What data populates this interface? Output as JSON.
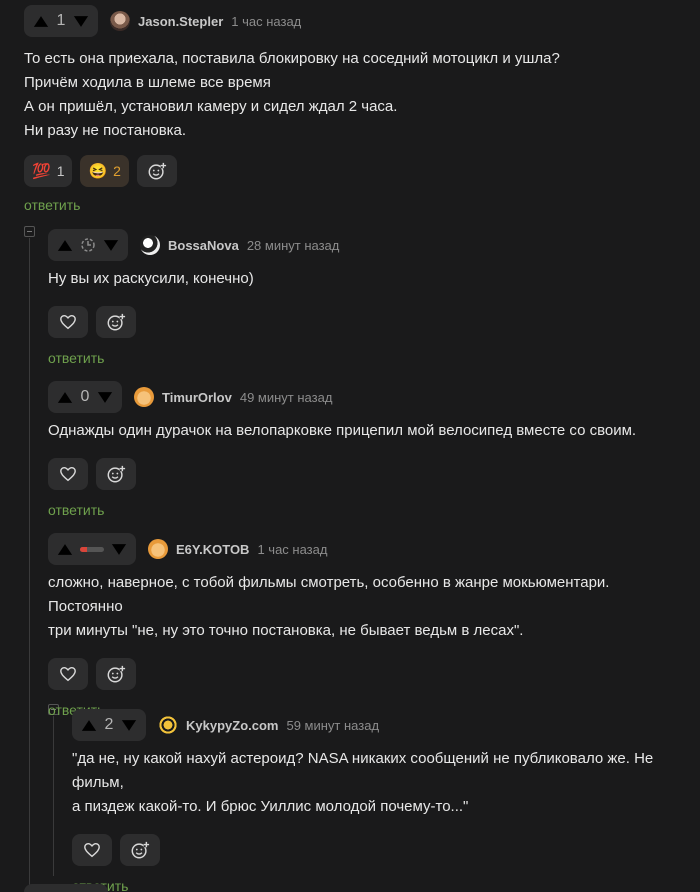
{
  "comments": [
    {
      "score": "1",
      "author": "Jason.Stepler",
      "time": "1 час назад",
      "lines": [
        "То есть она приехала, поставила блокировку на соседний мотоцикл и ушла?",
        "Причём ходила в шлеме все время",
        "А он пришёл, установил камеру и сидел ждал 2 часа.",
        "Ни разу не постановка."
      ],
      "reactions": [
        {
          "icon": "hundred-points-icon",
          "glyph": "💯",
          "count": "1"
        },
        {
          "icon": "laughing-face-icon",
          "glyph": "😆",
          "count": "2"
        }
      ],
      "reply": "ответить"
    },
    {
      "score": "",
      "author": "BossaNova",
      "time": "28 минут назад",
      "lines": [
        "Ну вы их раскусили, конечно)"
      ],
      "reply": "ответить"
    },
    {
      "score": "0",
      "author": "TimurOrlov",
      "time": "49 минут назад",
      "lines": [
        "Однажды один дурачок на велопарковке прицепил мой велосипед вместе со своим."
      ],
      "reply": "ответить"
    },
    {
      "score": "",
      "author": "E6Y.KOTOB",
      "time": "1 час назад",
      "lines": [
        "сложно, наверное, с тобой фильмы смотреть, особенно в жанре мокьюментари. Постоянно",
        "три минуты \"не, ну это точно постановка, не бывает ведьм в лесах\"."
      ],
      "reply": "ответить"
    },
    {
      "score": "2",
      "author": "KykypyZo.com",
      "time": "59 минут назад",
      "lines": [
        "\"да не, ну какой нахуй астероид? NASA никаких сообщений не публиковало же. Не фильм,",
        "а пиздеж какой-то. И брюс Уиллис молодой почему-то...\""
      ],
      "reply": "ответить"
    }
  ],
  "colors": {
    "background": "#1a1a1b",
    "panel": "#2d2d2e",
    "upvote_active": "#8ac858",
    "reply_link": "#6fa14d"
  }
}
